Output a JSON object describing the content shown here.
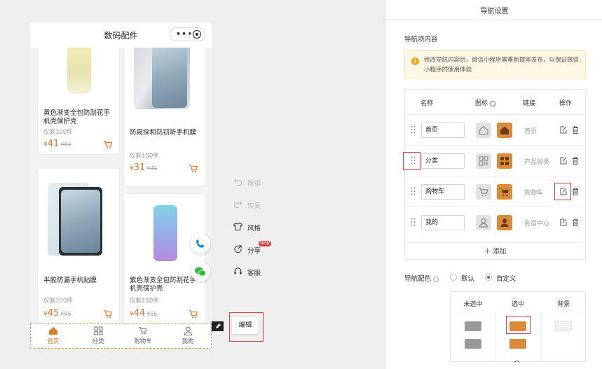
{
  "phone": {
    "title": "数码配件",
    "capsule_more": "•••",
    "products": [
      {
        "title": "黄色渐变全包防刮花手机壳保护壳",
        "stock": "仅剩100件",
        "currency": "¥",
        "price": "41",
        "old_price": "¥51"
      },
      {
        "title": "防窥探和防窃听手机膜",
        "stock": "仅剩100件",
        "currency": "¥",
        "price": "31",
        "old_price": "¥41"
      },
      {
        "title": "半胶防漏手机贴膜",
        "stock": "仅剩100件",
        "currency": "¥",
        "price": "45",
        "old_price": "¥55"
      },
      {
        "title": "紫色渐变全包防刮花手机壳保护壳",
        "stock": "仅剩100件",
        "currency": "¥",
        "price": "44",
        "old_price": "¥55"
      }
    ],
    "tabs": [
      {
        "label": "首页",
        "icon": "home-icon",
        "active": true
      },
      {
        "label": "分类",
        "icon": "grid-icon",
        "active": false
      },
      {
        "label": "购物车",
        "icon": "cart-icon",
        "active": false
      },
      {
        "label": "我的",
        "icon": "user-icon",
        "active": false
      }
    ]
  },
  "canvas": {
    "edit_button": "编辑",
    "tools": [
      {
        "label": "撤销",
        "icon": "undo-icon",
        "disabled": true
      },
      {
        "label": "恢复",
        "icon": "redo-icon",
        "disabled": true
      },
      {
        "label": "风格",
        "icon": "shirt-icon",
        "disabled": false
      },
      {
        "label": "分享",
        "icon": "share-icon",
        "disabled": false,
        "badge": "NEW"
      },
      {
        "label": "客服",
        "icon": "headset-icon",
        "disabled": false
      }
    ]
  },
  "panel": {
    "title": "导航设置",
    "content_label": "导航项内容",
    "notice": "修改导航内容后，微信小程序需重新提审发布，以保证微信小程序的使用体验",
    "table_headers": {
      "name": "名称",
      "icon": "图标",
      "link": "链接",
      "action": "操作"
    },
    "nav_items": [
      {
        "name": "首页",
        "link": "首页",
        "icon": "home-icon"
      },
      {
        "name": "分类",
        "link": "产品分类",
        "icon": "grid-icon"
      },
      {
        "name": "购物车",
        "link": "购物车",
        "icon": "cart-icon"
      },
      {
        "name": "我的",
        "link": "会员中心",
        "icon": "user-icon"
      }
    ],
    "add_label": "添加",
    "color_label": "导航配色",
    "radio_default": "默认",
    "radio_custom": "自定义",
    "radio_selected": "自定义",
    "color_headers": {
      "unselected": "未选中",
      "selected": "选中",
      "background": "背景"
    },
    "colors": {
      "unselected": "#999999",
      "selected": "#d98a3a",
      "background": "#f2f2f2",
      "accent": "#e0782d",
      "highlight": "#e03c3c"
    }
  }
}
